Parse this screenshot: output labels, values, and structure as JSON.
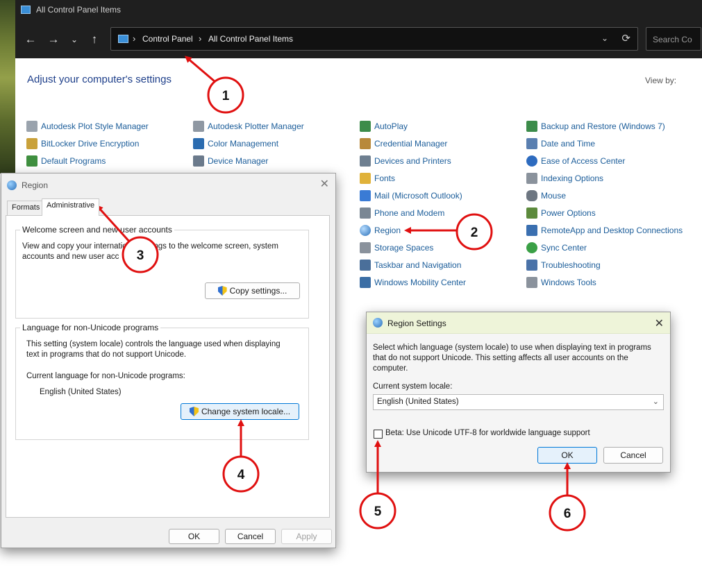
{
  "window": {
    "title": "All Control Panel Items",
    "breadcrumb": [
      "Control Panel",
      "All Control Panel Items"
    ],
    "search_placeholder": "Search Co",
    "heading": "Adjust your computer's settings",
    "view_by": "View by:"
  },
  "items": {
    "col1": [
      "Autodesk Plot Style Manager",
      "BitLocker Drive Encryption",
      "Default Programs"
    ],
    "col2": [
      "Autodesk Plotter Manager",
      "Color Management",
      "Device Manager"
    ],
    "col3": [
      "AutoPlay",
      "Credential Manager",
      "Devices and Printers",
      "Fonts",
      "Mail (Microsoft Outlook)",
      "Phone and Modem",
      "Region",
      "Storage Spaces",
      "Taskbar and Navigation",
      "Windows Mobility Center"
    ],
    "col4": [
      "Backup and Restore (Windows 7)",
      "Date and Time",
      "Ease of Access Center",
      "Indexing Options",
      "Mouse",
      "Power Options",
      "RemoteApp and Desktop Connections",
      "Sync Center",
      "Troubleshooting",
      "Windows Tools"
    ]
  },
  "region": {
    "title": "Region",
    "tabs": [
      "Formats",
      "Administrative"
    ],
    "welcome_legend": "Welcome screen and new user accounts",
    "welcome_text_1": "View and copy your internation",
    "welcome_text_1b": "settings to the welcome screen, system",
    "welcome_text_2": "accounts and new user acc",
    "copy_button": "Copy settings...",
    "nonunicode_legend": "Language for non-Unicode programs",
    "nonunicode_text_1": "This setting (system locale) controls the language used when displaying",
    "nonunicode_text_2": "text in programs that do not support Unicode.",
    "current_label": "Current language for non-Unicode programs:",
    "current_value": "English (United States)",
    "change_button": "Change system locale...",
    "ok": "OK",
    "cancel": "Cancel",
    "apply": "Apply"
  },
  "region_settings": {
    "title": "Region Settings",
    "desc_1": "Select which language (system locale) to use when displaying text in programs",
    "desc_2": "that do not support Unicode. This setting affects all user accounts on the",
    "desc_3": "computer.",
    "locale_label": "Current system locale:",
    "locale_value": "English (United States)",
    "beta_label": "Beta: Use Unicode UTF-8 for worldwide language support",
    "ok": "OK",
    "cancel": "Cancel"
  },
  "steps": [
    "1",
    "2",
    "3",
    "4",
    "5",
    "6"
  ],
  "colors": {
    "annotation_red": "#e01010",
    "link_blue": "#1a5c99",
    "heading_blue": "#1e3f8a"
  }
}
